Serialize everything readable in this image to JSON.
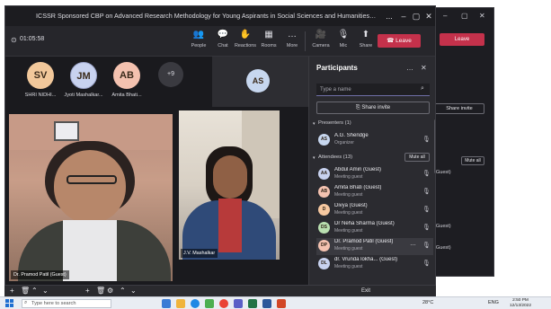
{
  "window": {
    "title": "ICSSR Sponsored CBP on Advanced Research Methodology for Young Aspirants in Social Sciences and Humanities Organized ...",
    "controls": {
      "more": "...",
      "minimize": "–",
      "maximize": "▢",
      "close": "✕"
    }
  },
  "meeting": {
    "timer": "01:05:58",
    "toolbar": {
      "people": "People",
      "chat": "Chat",
      "reactions": "Reactions",
      "rooms": "Rooms",
      "more": "More",
      "camera": "Camera",
      "mic": "Mic",
      "share": "Share",
      "leave": "Leave"
    },
    "gallery": [
      {
        "initials": "SV",
        "label": "SHRI NIDHI...",
        "color": "#f2c89b"
      },
      {
        "initials": "JM",
        "label": "Jyoti Mashalkar...",
        "color": "#c8d2ef"
      },
      {
        "initials": "AB",
        "label": "Amita Bhati...",
        "color": "#f4c2b0"
      }
    ],
    "overflow_count": "+9",
    "pinned": {
      "initials": "AS",
      "color": "#c7d7ef"
    },
    "video_tiles": [
      {
        "name": "Dr. Pramod Patil (Guest)"
      },
      {
        "name": "J.V. Mashalkar"
      }
    ]
  },
  "participants": {
    "title": "Participants",
    "search_placeholder": "Type a name",
    "share_invite": "Share invite",
    "presenters_header": "Presenters (1)",
    "attendees_header": "Attendees (13)",
    "mute_all": "Mute all",
    "presenters": [
      {
        "initials": "AS",
        "name": "A.G. Shendge",
        "role": "Organizer",
        "color": "#c7d7ef"
      }
    ],
    "attendees": [
      {
        "initials": "AA",
        "name": "Abdul Amin (Guest)",
        "role": "Meeting guest",
        "color": "#c8d2ef"
      },
      {
        "initials": "AB",
        "name": "Amita Bhati (Guest)",
        "role": "Meeting guest",
        "color": "#f4c2b0"
      },
      {
        "initials": "D",
        "name": "Divya (Guest)",
        "role": "Meeting guest",
        "color": "#f6c8a0"
      },
      {
        "initials": "DS",
        "name": "Dr Neha Sharma (Guest)",
        "role": "Meeting guest",
        "color": "#b9dfb0"
      },
      {
        "initials": "DP",
        "name": "Dr. Pramod Patil (Guest)",
        "role": "Meeting guest",
        "color": "#f4c2b0"
      },
      {
        "initials": "DL",
        "name": "dr. Vrunda lokha... (Guest)",
        "role": "Meeting guest",
        "color": "#c8d2ef"
      }
    ]
  },
  "back_window": {
    "leave": "Leave",
    "share_invite": "Share invite",
    "mute_all": "Mute all",
    "guest_label": "(Guest)"
  },
  "bottom_bar": {
    "exit": "Exit"
  },
  "taskbar": {
    "search_placeholder": "Type here to search",
    "temperature": "28°C",
    "language": "ENG",
    "time": "2:50 PM",
    "date": "12/13/2022"
  }
}
